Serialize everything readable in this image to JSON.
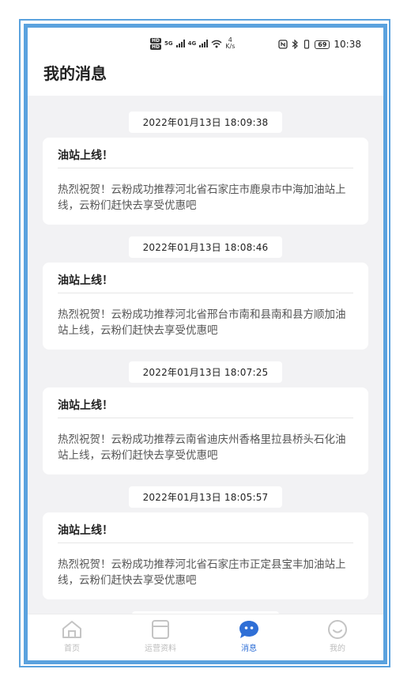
{
  "statusbar": {
    "net_badge_1": "HD",
    "net_badge_2": "HD",
    "net_5g": "5G",
    "net_4g": "4G",
    "speed_value": "4",
    "speed_unit": "K/s",
    "battery": "69",
    "time": "10:38"
  },
  "header": {
    "title": "我的消息"
  },
  "messages": [
    {
      "time": "2022年01月13日 18:09:38",
      "title": "油站上线！",
      "body": "热烈祝贺！云粉成功推荐河北省石家庄市鹿泉市中海加油站上线，云粉们赶快去享受优惠吧"
    },
    {
      "time": "2022年01月13日 18:08:46",
      "title": "油站上线！",
      "body": "热烈祝贺！云粉成功推荐河北省邢台市南和县南和县方顺加油站上线，云粉们赶快去享受优惠吧"
    },
    {
      "time": "2022年01月13日 18:07:25",
      "title": "油站上线！",
      "body": "热烈祝贺！云粉成功推荐云南省迪庆州香格里拉县桥头石化油站上线，云粉们赶快去享受优惠吧"
    },
    {
      "time": "2022年01月13日 18:05:57",
      "title": "油站上线！",
      "body": "热烈祝贺！云粉成功推荐河北省石家庄市正定县宝丰加油站上线，云粉们赶快去享受优惠吧"
    }
  ],
  "tabs": [
    {
      "label": "首页",
      "icon": "home-icon"
    },
    {
      "label": "运营资料",
      "icon": "document-icon"
    },
    {
      "label": "消息",
      "icon": "message-icon",
      "active": true
    },
    {
      "label": "我的",
      "icon": "profile-icon"
    }
  ],
  "colors": {
    "accent": "#2f6fd6",
    "frame": "#5aa2de",
    "background": "#f2f2f4"
  }
}
